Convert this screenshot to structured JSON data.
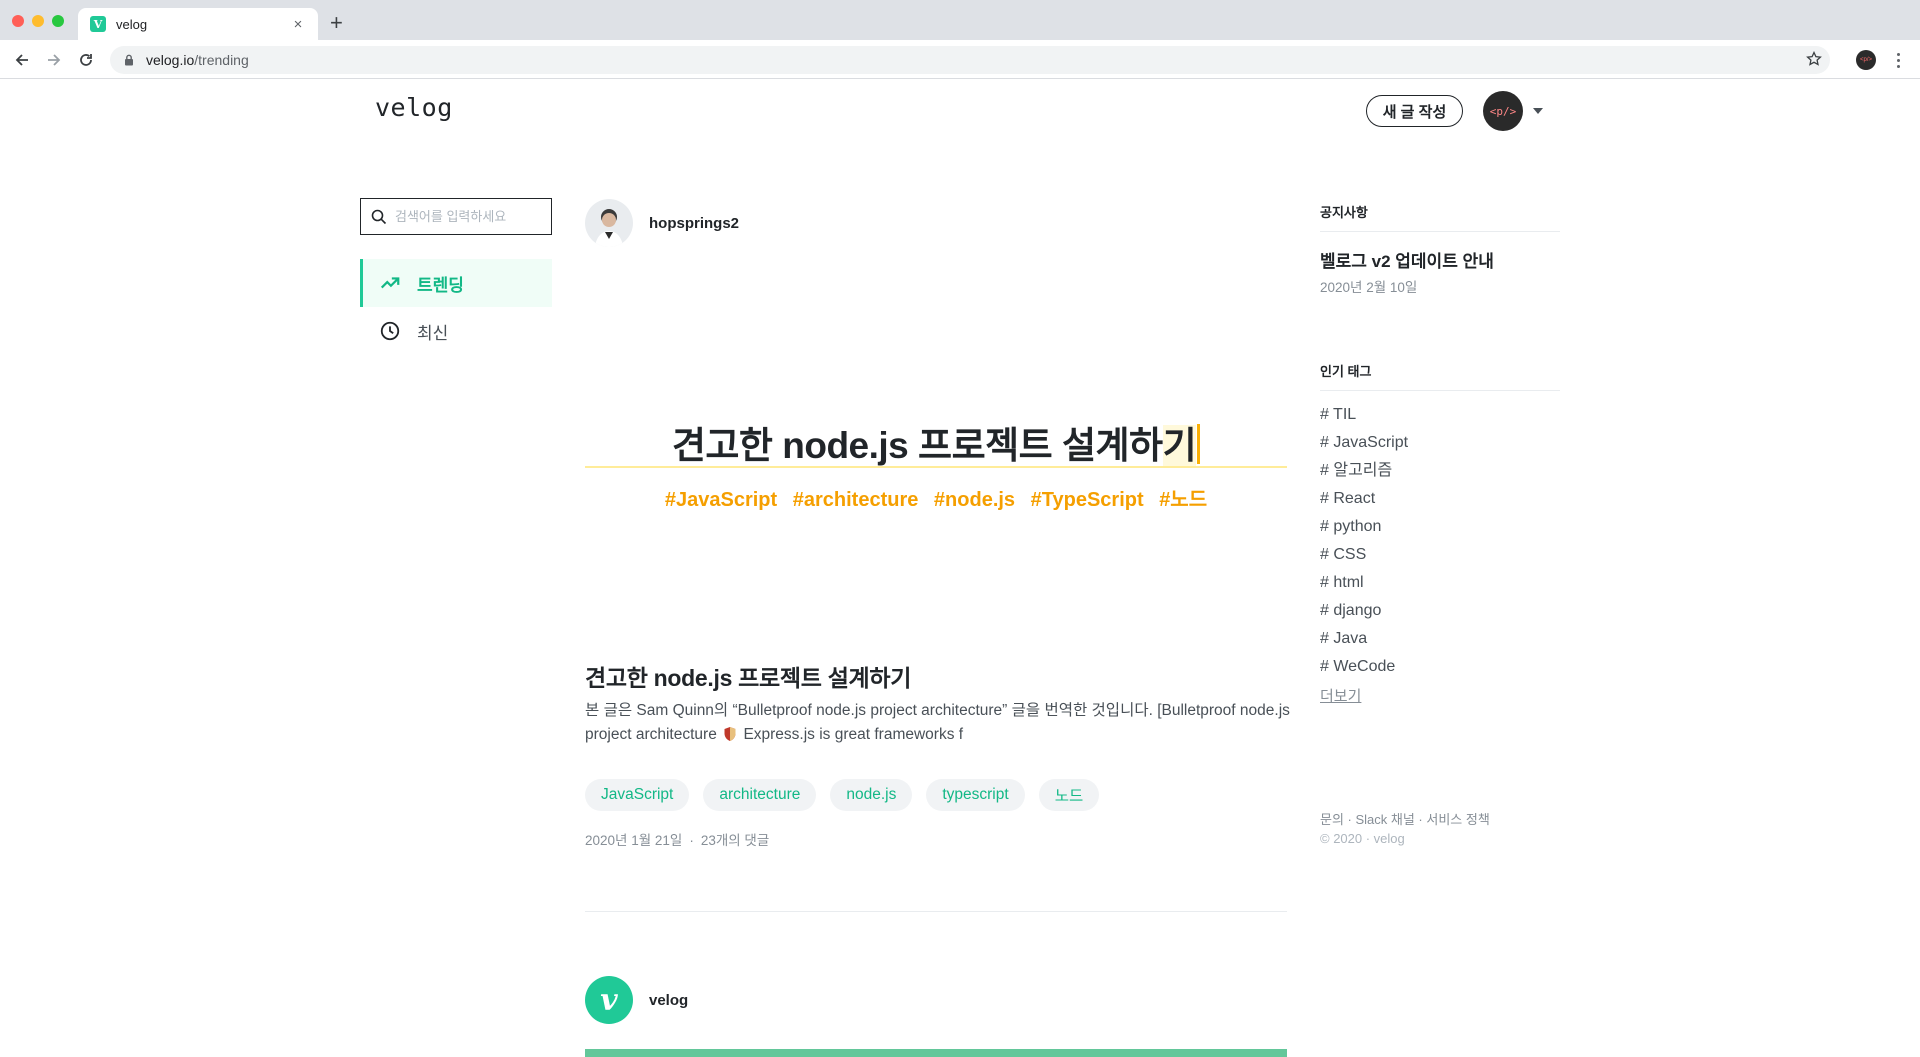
{
  "browser": {
    "tab_title": "velog",
    "tab_favicon_letter": "V",
    "tab_close": "×",
    "new_tab": "+",
    "url_host": "velog.io",
    "url_path": "/trending",
    "profile_label": "<p/>"
  },
  "header": {
    "logo": "velog",
    "write_button": "새 글 작성",
    "avatar_label": "<p/>"
  },
  "sidebar": {
    "search_placeholder": "검색어를 입력하세요",
    "nav": [
      {
        "label": "트렌딩",
        "icon": "trending-up-icon",
        "active": true
      },
      {
        "label": "최신",
        "icon": "clock-icon",
        "active": false
      }
    ]
  },
  "feed": {
    "posts": [
      {
        "author": "hopsprings2",
        "thumbnail_title_main": "견고한 node.js 프로젝트 설계하",
        "thumbnail_title_highlight": "기",
        "thumbnail_tags": [
          "#JavaScript",
          "#architecture",
          "#node.js",
          "#TypeScript",
          "#노드"
        ],
        "title": "견고한 node.js 프로젝트 설계하기",
        "description_part1": "본 글은 Sam Quinn의 “Bulletproof node.js project architecture” 글을 번역한 것입니다. [Bulletproof node.js project architecture",
        "description_part2": "Express.js is great frameworks f",
        "tags": [
          "JavaScript",
          "architecture",
          "node.js",
          "typescript",
          "노드"
        ],
        "date": "2020년 1월 21일",
        "meta_separator": "·",
        "comments": "23개의 댓글"
      },
      {
        "author": "velog",
        "avatar_letter": "v"
      }
    ]
  },
  "notice": {
    "heading": "공지사항",
    "title": "벨로그 v2 업데이트 안내",
    "date": "2020년 2월 10일"
  },
  "popular_tags": {
    "heading": "인기 태그",
    "items": [
      "# TIL",
      "# JavaScript",
      "# 알고리즘",
      "# React",
      "# python",
      "# CSS",
      "# html",
      "# django",
      "# Java",
      "# WeCode"
    ],
    "more": "더보기"
  },
  "footer": {
    "contact": "문의",
    "slack": "Slack 채널",
    "policy": "서비스 정책",
    "separator": " · ",
    "copyright": "© 2020 · velog"
  },
  "colors": {
    "accent": "#20c997",
    "thumbnail_tag": "#f59f00",
    "thumbnail_underline": "#ffec99"
  }
}
